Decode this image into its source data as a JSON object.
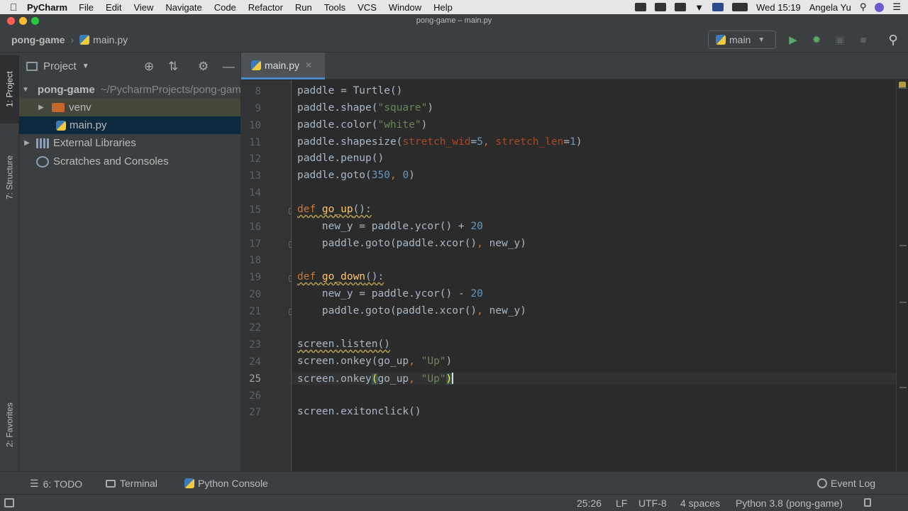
{
  "menubar": {
    "app_name": "PyCharm",
    "items": [
      "File",
      "Edit",
      "View",
      "Navigate",
      "Code",
      "Refactor",
      "Run",
      "Tools",
      "VCS",
      "Window",
      "Help"
    ],
    "clock": "Wed 15:19",
    "user": "Angela Yu"
  },
  "window": {
    "title": "pong-game – main.py"
  },
  "navbar": {
    "project": "pong-game",
    "file": "main.py",
    "run_config": "main"
  },
  "tool_strip": {
    "project_tab": "1: Project",
    "structure_tab": "7: Structure",
    "favorites_tab": "2: Favorites"
  },
  "project_panel": {
    "title": "Project",
    "tree": [
      {
        "label": "pong-game",
        "sub": "~/PycharmProjects/pong-game"
      },
      {
        "label": "venv"
      },
      {
        "label": "main.py"
      },
      {
        "label": "External Libraries"
      },
      {
        "label": "Scratches and Consoles"
      }
    ]
  },
  "editor": {
    "tab_label": "main.py",
    "line_numbers": [
      "8",
      "9",
      "10",
      "11",
      "12",
      "13",
      "14",
      "15",
      "16",
      "17",
      "18",
      "19",
      "20",
      "21",
      "22",
      "23",
      "24",
      "25",
      "26",
      "27"
    ],
    "current_line": "25"
  },
  "bottom_tools": {
    "todo": "6: TODO",
    "terminal": "Terminal",
    "python_console": "Python Console",
    "event_log": "Event Log"
  },
  "statusbar": {
    "position": "25:26",
    "line_sep": "LF",
    "encoding": "UTF-8",
    "indent": "4 spaces",
    "interpreter": "Python 3.8 (pong-game)"
  },
  "colors": {
    "editor_bg": "#2b2b2b",
    "panel_bg": "#3c3f41",
    "keyword": "#cc7832",
    "string": "#6a8759",
    "number": "#6897bb",
    "function": "#ffc66d"
  }
}
